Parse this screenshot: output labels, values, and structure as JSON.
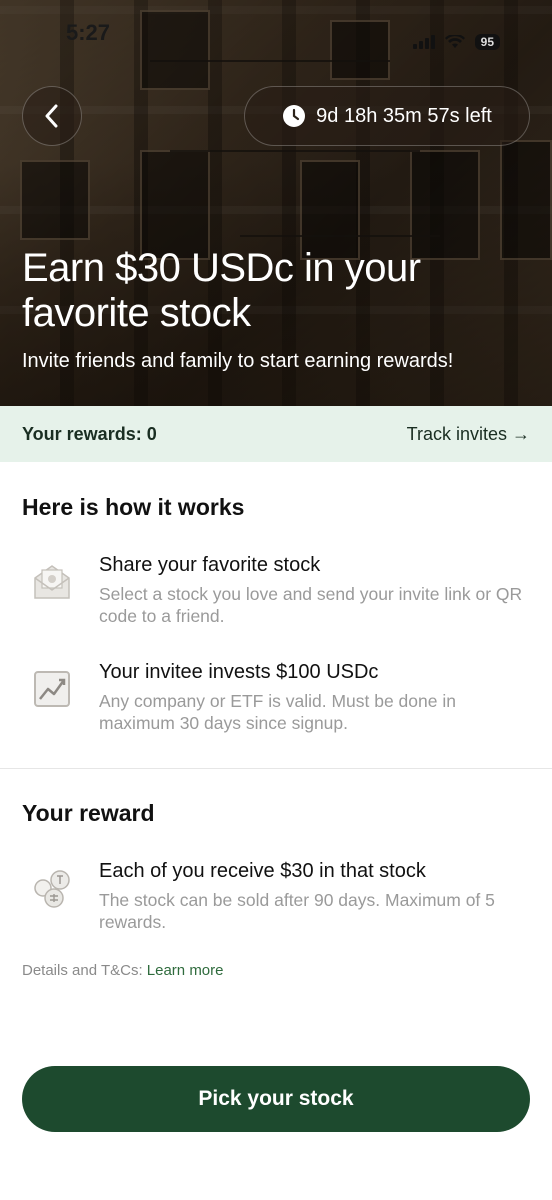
{
  "status_bar": {
    "time": "5:27",
    "battery": "95"
  },
  "header": {
    "timer": "9d 18h 35m 57s left"
  },
  "hero": {
    "title": "Earn $30 USDc in your favorite stock",
    "subtitle": "Invite friends and family to start earning rewards!"
  },
  "rewards": {
    "label": "Your rewards: 0",
    "track_invites": "Track invites →"
  },
  "how_it_works": {
    "title": "Here is how it works",
    "steps": [
      {
        "icon": "envelope-icon",
        "heading": "Share your favorite stock",
        "description": "Select a stock you love and send your invite link or QR code to a friend."
      },
      {
        "icon": "chart-icon",
        "heading": "Your invitee invests $100 USDc",
        "description": "Any company or ETF is valid. Must be done in maximum 30 days since signup."
      }
    ]
  },
  "reward": {
    "title": "Your reward",
    "step": {
      "icon": "coins-icon",
      "heading": "Each of you receive $30 in that stock",
      "description": "The stock can be sold after 90 days. Maximum of 5 rewards."
    }
  },
  "terms": {
    "prefix": "Details and T&Cs: ",
    "link": "Learn more"
  },
  "cta": {
    "label": "Pick your stock"
  },
  "colors": {
    "brand_green": "#1d4a2e",
    "rewards_bg": "#e6f2ea",
    "link_green": "#2f6b3d"
  }
}
